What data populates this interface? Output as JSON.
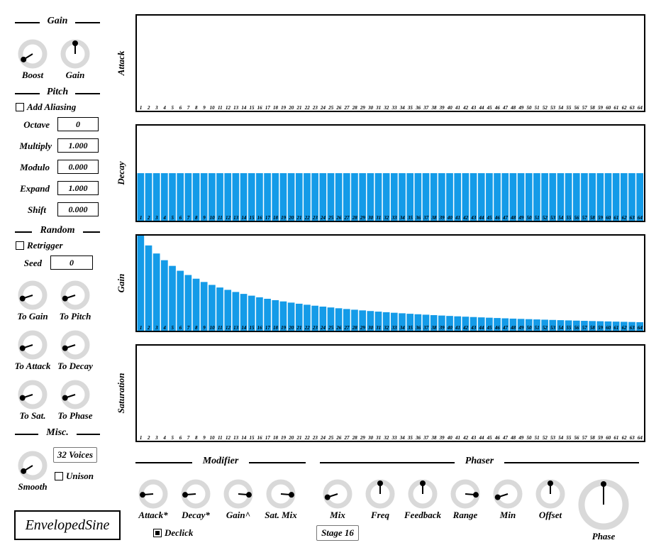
{
  "sections": {
    "gain": "Gain",
    "pitch": "Pitch",
    "random": "Random",
    "misc": "Misc.",
    "modifier": "Modifier",
    "phaser": "Phaser"
  },
  "gain_knobs": [
    {
      "label": "Boost",
      "value": 0.05
    },
    {
      "label": "Gain",
      "value": 0.5
    }
  ],
  "pitch": {
    "add_aliasing": {
      "label": "Add Aliasing",
      "checked": false
    },
    "fields": [
      {
        "label": "Octave",
        "value": "0"
      },
      {
        "label": "Multiply",
        "value": "1.000"
      },
      {
        "label": "Modulo",
        "value": "0.000"
      },
      {
        "label": "Expand",
        "value": "1.000"
      },
      {
        "label": "Shift",
        "value": "0.000"
      }
    ]
  },
  "random": {
    "retrigger": {
      "label": "Retrigger",
      "checked": false
    },
    "seed": {
      "label": "Seed",
      "value": "0"
    },
    "knobs": [
      {
        "label": "To Gain",
        "value": 0.1
      },
      {
        "label": "To Pitch",
        "value": 0.1
      },
      {
        "label": "To Attack",
        "value": 0.1
      },
      {
        "label": "To Decay",
        "value": 0.1
      },
      {
        "label": "To Sat.",
        "value": 0.1
      },
      {
        "label": "To Phase",
        "value": 0.1
      }
    ]
  },
  "misc": {
    "smooth": {
      "label": "Smooth",
      "value": 0.05
    },
    "voices": "32 Voices",
    "unison": {
      "label": "Unison",
      "checked": false
    }
  },
  "plugin_name": "EnvelopedSine",
  "panels": [
    {
      "label": "Attack",
      "values": []
    },
    {
      "label": "Decay",
      "values": "decay"
    },
    {
      "label": "Gain",
      "values": "gain"
    },
    {
      "label": "Saturation",
      "values": []
    }
  ],
  "bar_count": 64,
  "decay_level": 0.5,
  "modifier": {
    "knobs": [
      {
        "label": "Attack*",
        "value": 0.15
      },
      {
        "label": "Decay*",
        "value": 0.15
      },
      {
        "label": "Gain^",
        "value": 0.85
      },
      {
        "label": "Sat. Mix",
        "value": 0.85
      }
    ],
    "declick": {
      "label": "Declick",
      "checked": true
    }
  },
  "phaser": {
    "knobs": [
      {
        "label": "Mix",
        "value": 0.1
      },
      {
        "label": "Freq",
        "value": 0.5
      },
      {
        "label": "Feedback",
        "value": 0.5
      },
      {
        "label": "Range",
        "value": 0.85
      },
      {
        "label": "Min",
        "value": 0.1
      },
      {
        "label": "Offset",
        "value": 0.5
      }
    ],
    "stage": "Stage 16",
    "phase": {
      "label": "Phase",
      "value": 0.5
    }
  },
  "colors": {
    "bar": "#149be8",
    "knob_track": "#d9d9d9"
  }
}
